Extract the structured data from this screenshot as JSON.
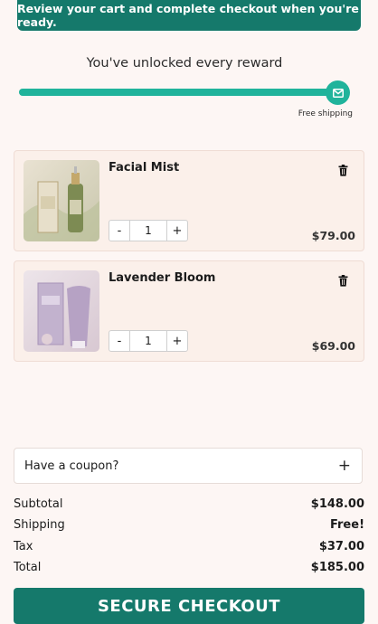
{
  "banner": {
    "text": "Review your cart and complete checkout when you're ready."
  },
  "rewards": {
    "title": "You've unlocked every reward",
    "progress": 1.0,
    "milestone_label": "Free shipping",
    "milestone_icon": "envelope-icon"
  },
  "cart": {
    "items": [
      {
        "name": "Facial Mist",
        "quantity": "1",
        "price": "$79.00",
        "minus": "-",
        "plus": "+"
      },
      {
        "name": "Lavender Bloom",
        "quantity": "1",
        "price": "$69.00",
        "minus": "-",
        "plus": "+"
      }
    ]
  },
  "coupon": {
    "label": "Have a coupon?",
    "toggle": "+"
  },
  "summary": {
    "subtotal_label": "Subtotal",
    "subtotal": "$148.00",
    "shipping_label": "Shipping",
    "shipping": "Free!",
    "tax_label": "Tax",
    "tax": "$37.00",
    "total_label": "Total",
    "total": "$185.00"
  },
  "checkout": {
    "label": "SECURE CHECKOUT"
  },
  "colors": {
    "accent": "#15796b",
    "progress": "#20b39b",
    "background": "#fdf6f4"
  }
}
